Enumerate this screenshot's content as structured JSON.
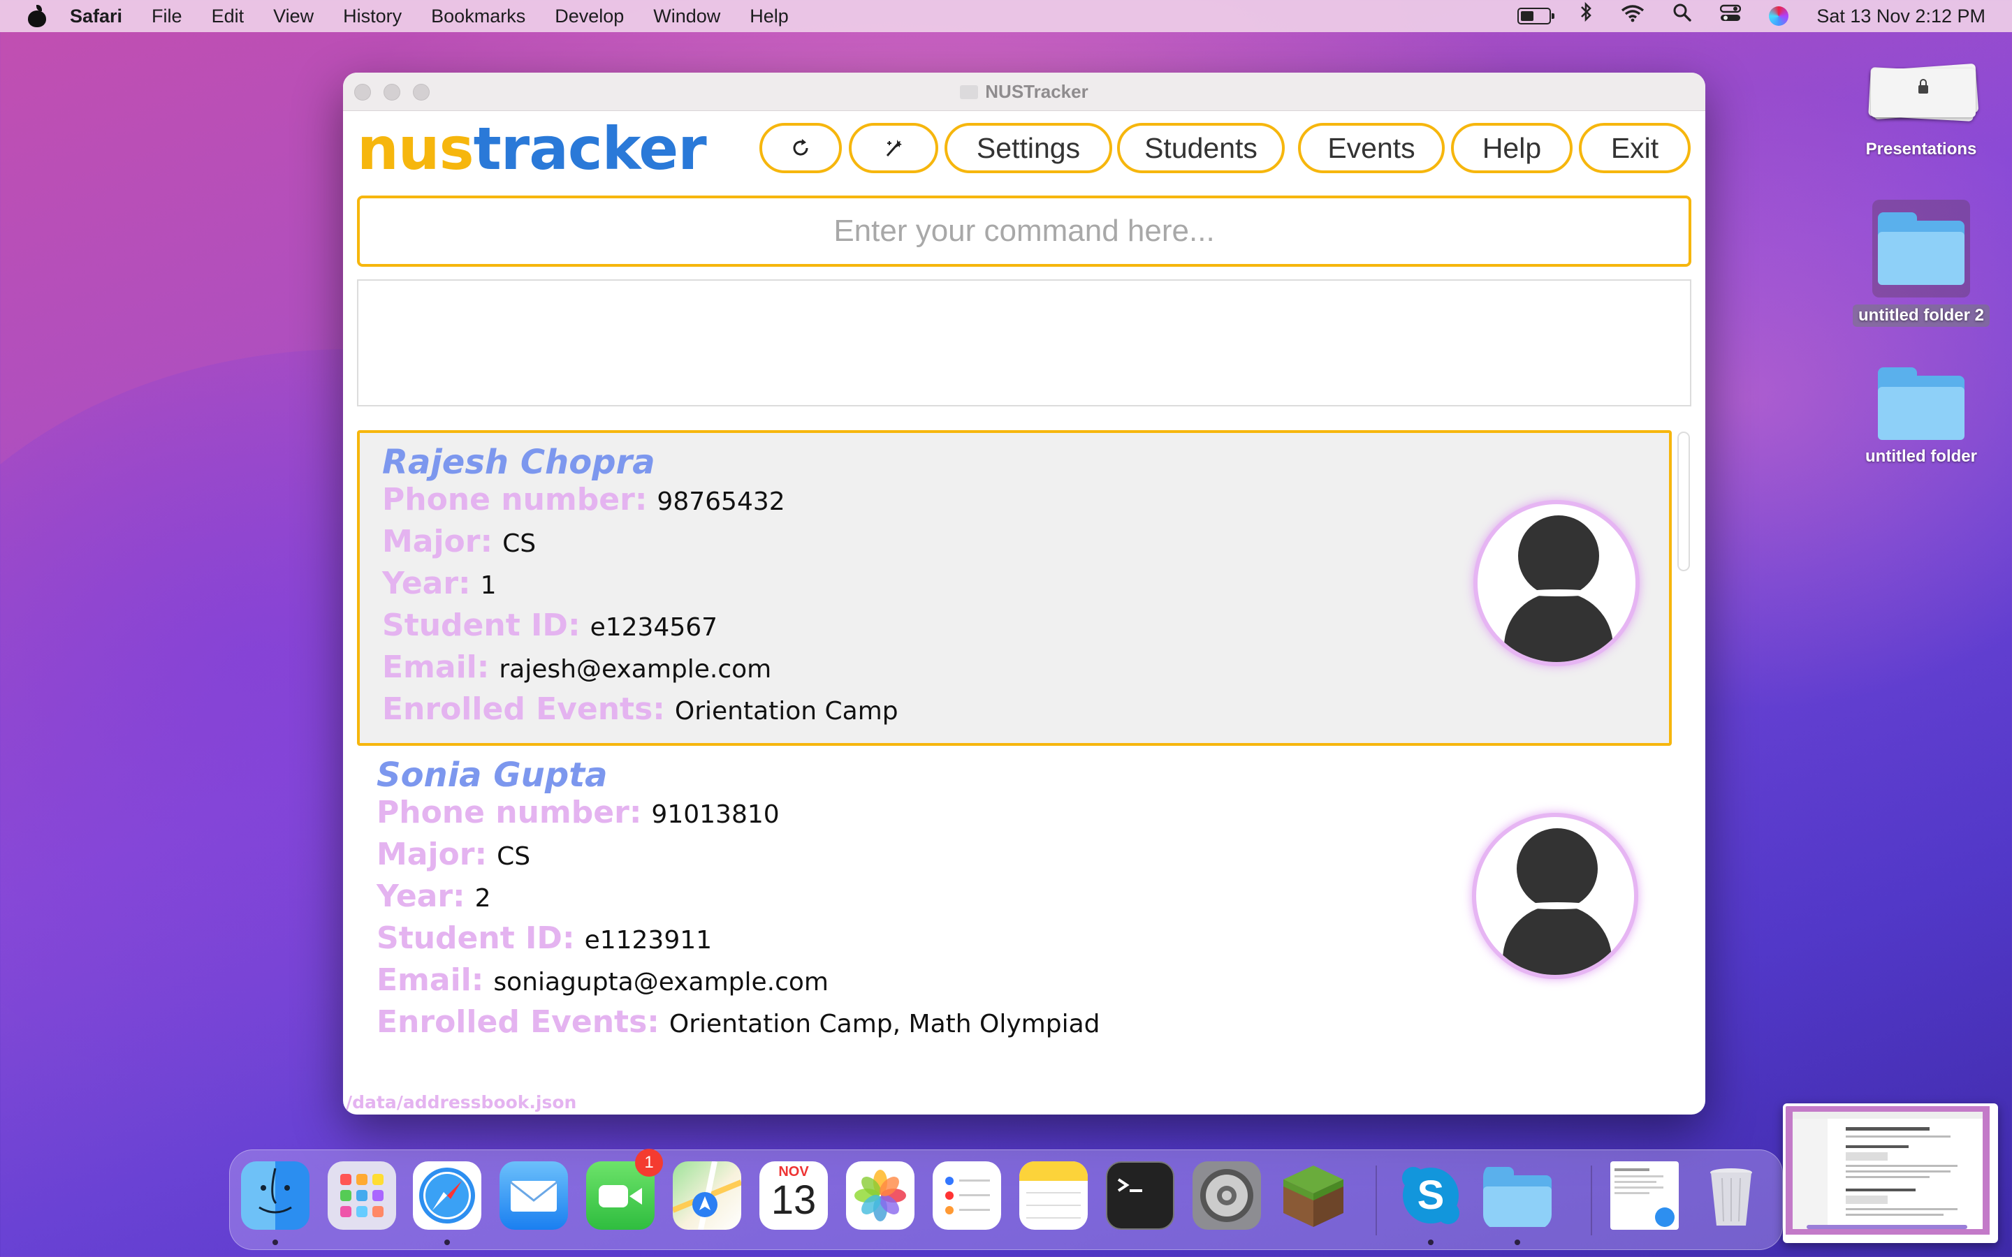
{
  "menubar": {
    "app_name": "Safari",
    "items": [
      "File",
      "Edit",
      "View",
      "History",
      "Bookmarks",
      "Develop",
      "Window",
      "Help"
    ],
    "clock": "Sat 13 Nov  2:12 PM",
    "icons": [
      "battery-icon",
      "bluetooth-icon",
      "wifi-icon",
      "spotlight-icon",
      "control-center-icon",
      "siri-icon"
    ]
  },
  "window": {
    "title": "NUSTracker",
    "logo_part1": "nus",
    "logo_part2": "tracker",
    "toolbar": {
      "refresh_icon": "refresh-icon",
      "theme_icon": "magic-wand-icon",
      "settings": "Settings",
      "students": "Students",
      "events": "Events",
      "help": "Help",
      "exit": "Exit"
    },
    "command_placeholder": "Enter your command here...",
    "command_value": "",
    "result_text": "",
    "status_path": "/data/addressbook.json"
  },
  "labels": {
    "phone": "Phone number:",
    "major": "Major:",
    "year": "Year:",
    "student_id": "Student ID:",
    "email": "Email:",
    "events": "Enrolled Events:"
  },
  "students": [
    {
      "name": "Rajesh Chopra",
      "phone": "98765432",
      "major": "CS",
      "year": "1",
      "student_id": "e1234567",
      "email": "rajesh@example.com",
      "events": "Orientation Camp"
    },
    {
      "name": "Sonia Gupta",
      "phone": "91013810",
      "major": "CS",
      "year": "2",
      "student_id": "e1123911",
      "email": "soniagupta@example.com",
      "events": "Orientation Camp, Math Olympiad"
    }
  ],
  "desktop": {
    "items": [
      {
        "label": "Presentations",
        "icon": "stack-icon"
      },
      {
        "label": "untitled folder 2",
        "icon": "folder-icon"
      },
      {
        "label": "untitled folder",
        "icon": "folder-icon"
      }
    ]
  },
  "dock": {
    "apps": [
      "Finder",
      "Launchpad",
      "Safari",
      "Mail",
      "FaceTime",
      "Maps",
      "Calendar",
      "Photos",
      "Reminders",
      "Notes",
      "Terminal",
      "System Preferences",
      "Minecraft",
      "Skype",
      "Folder",
      "Preview",
      "Trash"
    ],
    "facetime_badge": "1",
    "calendar_month": "NOV",
    "calendar_day": "13"
  },
  "colors": {
    "accent": "#f6b60d",
    "logo_blue": "#2a79d8",
    "name_blue": "#7c97ee",
    "label_pink": "#e4b3f0"
  }
}
